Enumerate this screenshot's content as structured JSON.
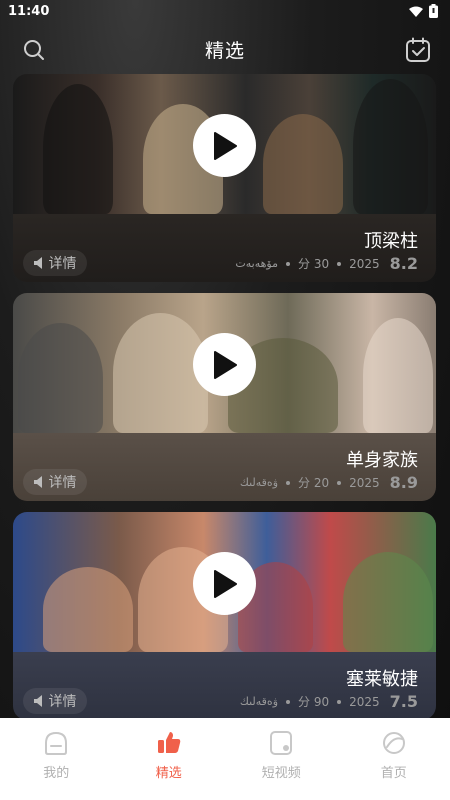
{
  "status_bar": {
    "time": "11:40"
  },
  "header": {
    "title": "精选"
  },
  "cards": [
    {
      "title": "顶梁柱",
      "detail_label": "详情",
      "meta_ug": "مۆھەبەت",
      "episodes": "分 30",
      "year": "2025",
      "rating": "8.2"
    },
    {
      "title": "单身家族",
      "detail_label": "详情",
      "meta_ug": "ۋەقەلىك",
      "episodes": "分 20",
      "year": "2025",
      "rating": "8.9"
    },
    {
      "title": "塞莱敏捷",
      "detail_label": "详情",
      "meta_ug": "ۋەقەلىك",
      "episodes": "分 90",
      "year": "2025",
      "rating": "7.5"
    }
  ],
  "tabs": [
    {
      "label": "我的",
      "icon": "face-icon",
      "active": false
    },
    {
      "label": "精选",
      "icon": "thumbs-up-icon",
      "active": true
    },
    {
      "label": "短视频",
      "icon": "short-video-icon",
      "active": false
    },
    {
      "label": "首页",
      "icon": "home-icon",
      "active": false
    }
  ],
  "colors": {
    "accent": "#f0604a",
    "inactive": "#b0b0b0"
  }
}
